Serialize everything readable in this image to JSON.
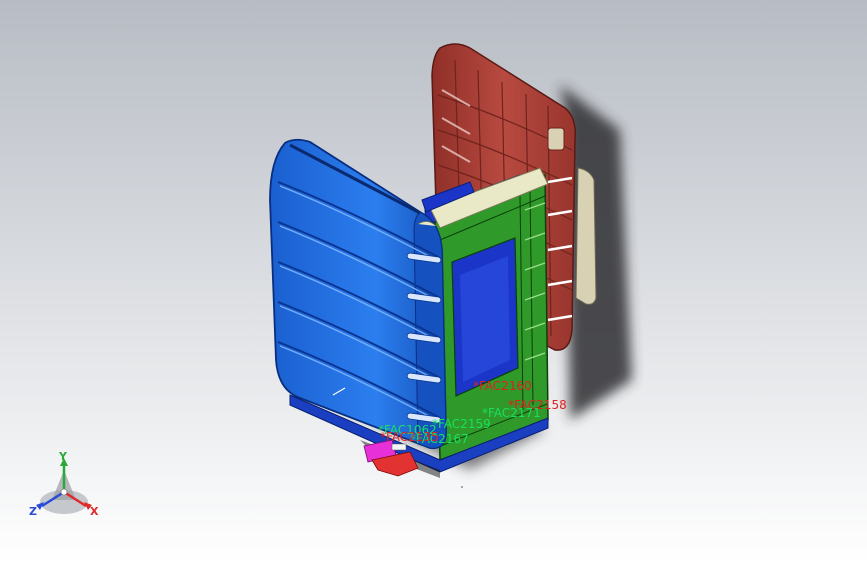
{
  "viewport": {
    "background_top": "#b7bcc4",
    "background_bottom": "#ffffff"
  },
  "model": {
    "colors": {
      "blue": "#1f6fe0",
      "blue_dark": "#0b3fa6",
      "blue_inner": "#1b35c8",
      "red": "#b0423a",
      "red_dark": "#7d2620",
      "green": "#2f9a2a",
      "green_dark": "#1c6318",
      "cream": "#e9e8c7",
      "beige": "#d8d1b4",
      "shadow": "#2e2f33",
      "magenta": "#e830d8",
      "red_small": "#e23232"
    }
  },
  "annotations": [
    {
      "text": "*FAC2160",
      "color": "#e02020"
    },
    {
      "text": "*FAC2158",
      "color": "#e02020"
    },
    {
      "text": "*FAC2171",
      "color": "#18e060"
    },
    {
      "text": "*FAC2159",
      "color": "#18e060"
    },
    {
      "text": "*FAC1062",
      "color": "#18e060"
    },
    {
      "text": "*FAC2167",
      "color": "#18e060"
    },
    {
      "text": "*FAC2135",
      "color": "#e02020"
    }
  ],
  "triad": {
    "x_label": "X",
    "y_label": "Y",
    "z_label": "Z",
    "x_color": "#e02a2a",
    "y_color": "#2aa838",
    "z_color": "#2a4ad8"
  }
}
